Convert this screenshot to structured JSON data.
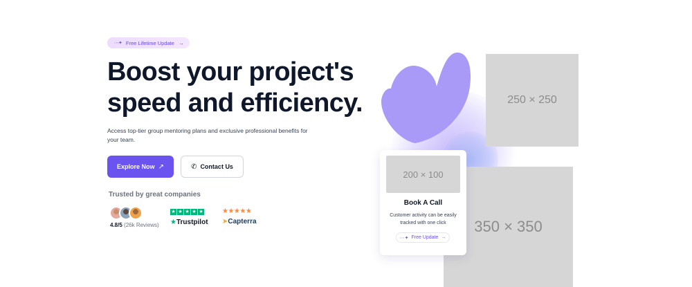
{
  "badge": {
    "icon": "sparkle-icon",
    "label": "Free Lifetime Update",
    "arrow": "→"
  },
  "hero": {
    "title_line1": "Boost your project's",
    "title_line2": "speed and efficiency.",
    "subtitle": "Access top-tier group mentoring plans and exclusive professional benefits for your team."
  },
  "buttons": {
    "explore": {
      "label": "Explore Now",
      "icon": "↗"
    },
    "contact": {
      "label": "Contact Us",
      "icon": "✆"
    }
  },
  "social_proof": {
    "heading": "Trusted by great companies",
    "rating_value": "4.8/5",
    "rating_reviews": "(26k Reviews)",
    "trustpilot": {
      "name": "Trustpilot",
      "stars": 5
    },
    "capterra": {
      "name": "Capterra",
      "stars": "★★★★★"
    }
  },
  "placeholders": {
    "large_top": "250 × 250",
    "large_bottom": "350 × 350",
    "card_image": "200 × 100"
  },
  "card": {
    "title": "Book A Call",
    "description": "Customer activity can be easily tracked with one click",
    "badge_label": "Free Update",
    "badge_arrow": "→"
  },
  "colors": {
    "accent": "#6a53ee",
    "leaf": "#a99af8",
    "trustpilot": "#00b67a",
    "capterra_star": "#ff8a3d"
  }
}
